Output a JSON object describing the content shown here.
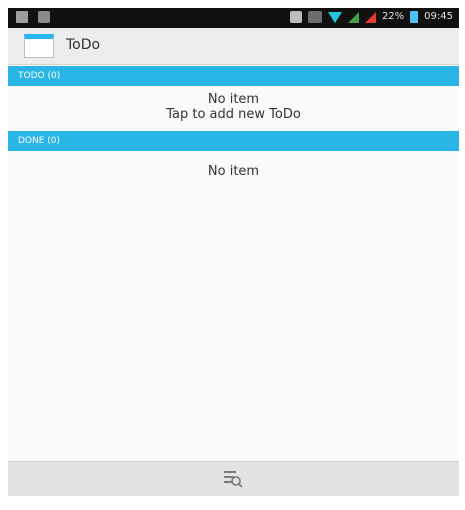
{
  "status_bar": {
    "battery_text": "22%",
    "time": "09:45"
  },
  "action_bar": {
    "title": "ToDo"
  },
  "sections": {
    "todo": {
      "header": "TODO (0)",
      "empty_line1": "No item",
      "empty_line2": "Tap to add new ToDo"
    },
    "done": {
      "header": "DONE (0)",
      "empty_line1": "No item"
    }
  },
  "colors": {
    "accent": "#29b6e6"
  },
  "icons": {
    "bottom": "search-list-icon"
  }
}
